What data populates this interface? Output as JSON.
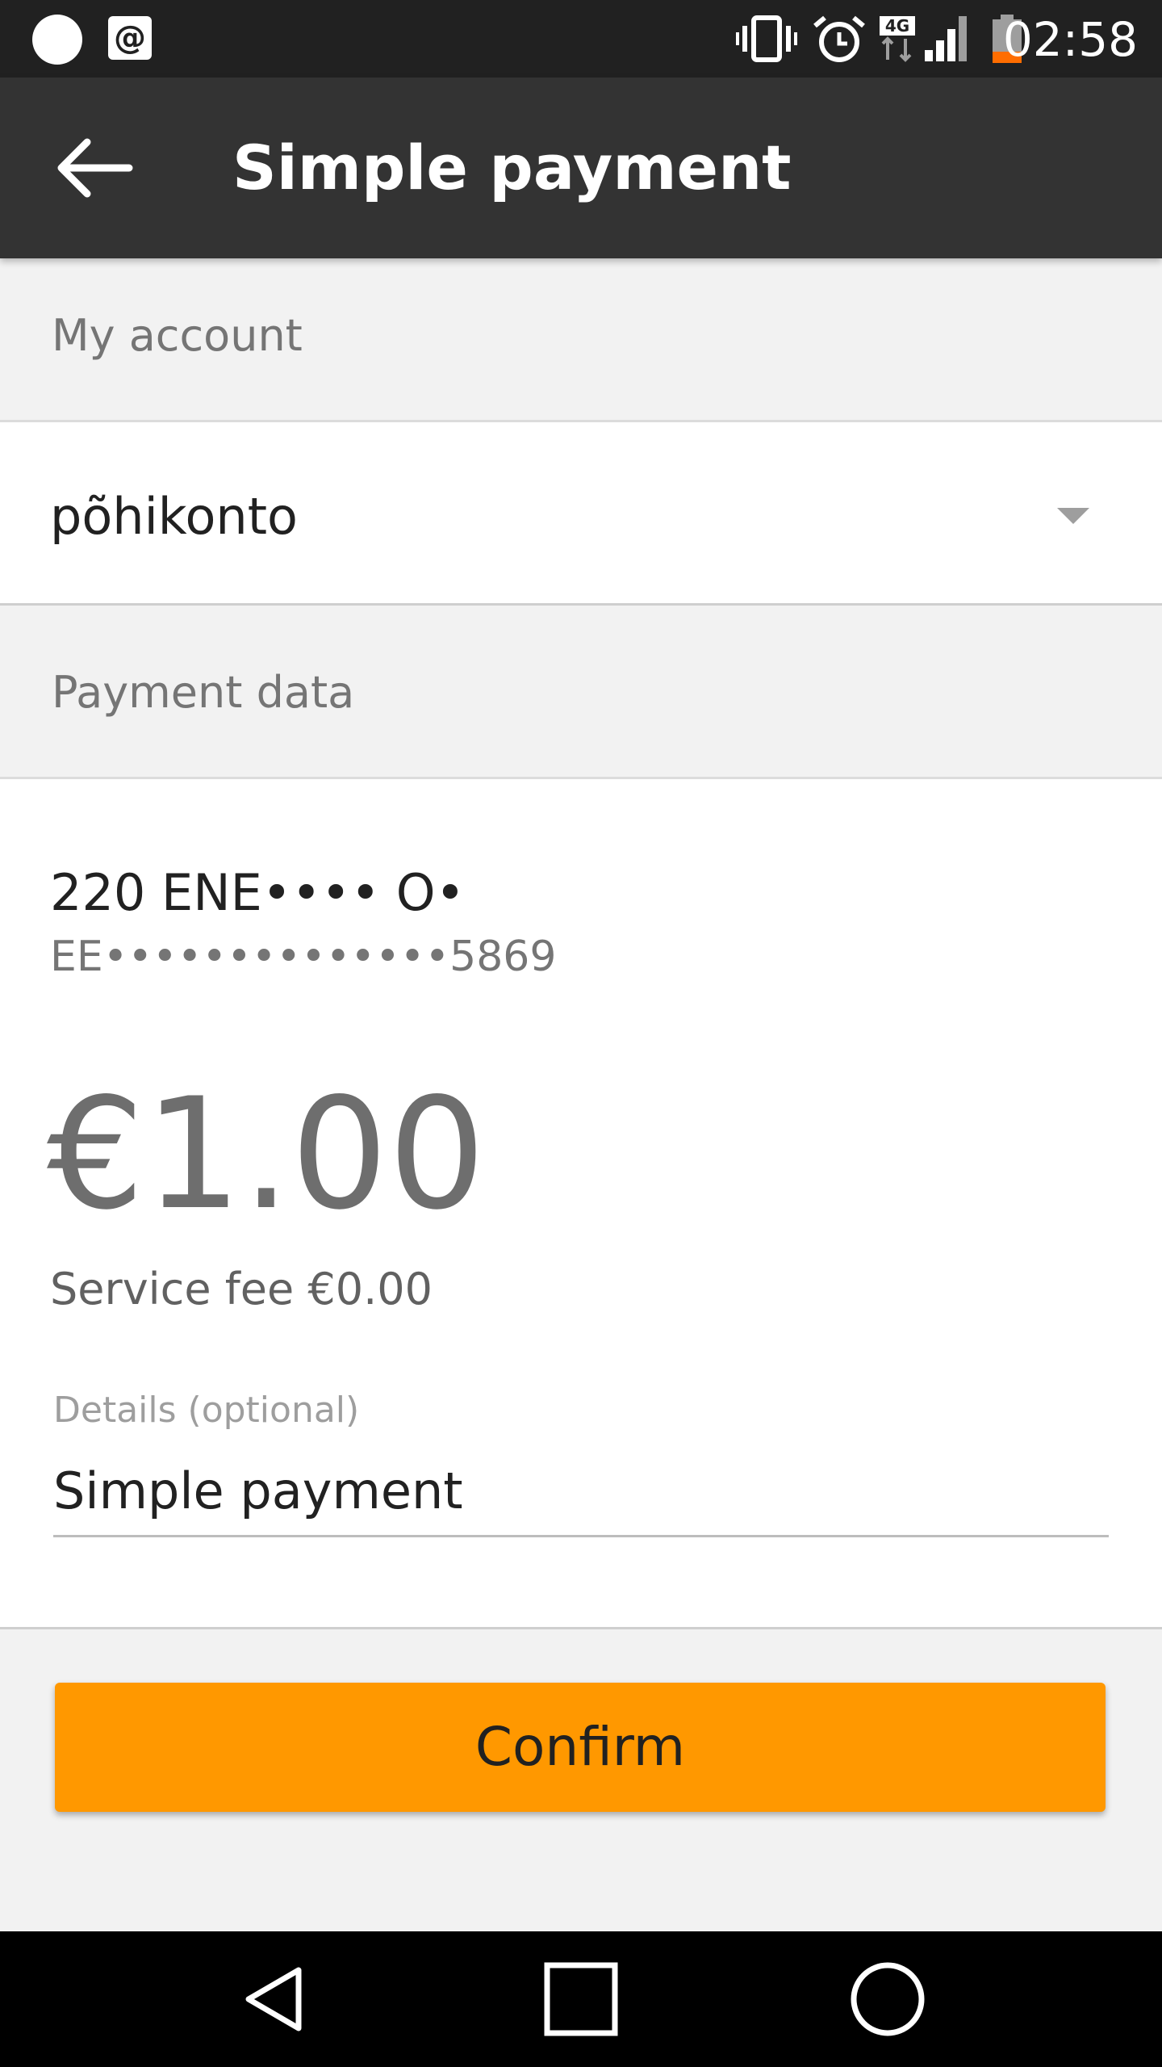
{
  "status_bar": {
    "time": "02:58",
    "icons": [
      "notification-dot-icon",
      "email-at-icon",
      "vibrate-icon",
      "alarm-icon",
      "network-4g-icon",
      "signal-icon",
      "battery-low-icon"
    ],
    "network_label": "4G",
    "battery_color": "#ff6d00"
  },
  "toolbar": {
    "title": "Simple payment",
    "back_icon": "arrow-back-icon"
  },
  "my_account": {
    "label": "My account",
    "selected": "põhikonto"
  },
  "payment_data": {
    "label": "Payment data",
    "recipient_name": "220 ENE•••• O•",
    "recipient_iban": "EE••••••••••••••5869",
    "amount": "€1.00",
    "service_fee": "Service fee €0.00",
    "details_label": "Details (optional)",
    "details_value": "Simple payment"
  },
  "confirm": {
    "label": "Confirm",
    "color": "#ff9800"
  },
  "navigation": {
    "icons": [
      "nav-back-icon",
      "nav-recents-icon",
      "nav-home-icon"
    ]
  }
}
